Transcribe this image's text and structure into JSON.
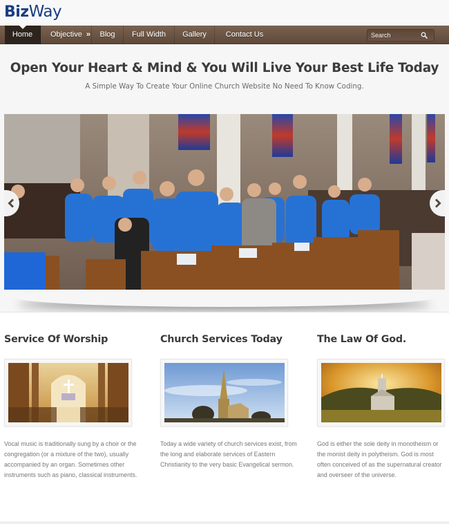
{
  "site": {
    "logo_bold": "Biz",
    "logo_light": "Way",
    "brand_color": "#1b3d82"
  },
  "nav": {
    "items": [
      {
        "label": "Home",
        "active": true
      },
      {
        "label": "Objective",
        "has_submenu": true,
        "submenu_indicator": "»"
      },
      {
        "label": "Blog"
      },
      {
        "label": "Full Width"
      },
      {
        "label": "Gallery"
      },
      {
        "label": "Contact Us"
      }
    ],
    "search": {
      "placeholder": "Search",
      "icon": "search-icon"
    },
    "bar_color": "#6b5444",
    "active_color": "#2e241e"
  },
  "hero": {
    "title": "Open Your Heart & Mind & You Will Live Your Best Life Today",
    "subtitle": "A Simple Way To Create Your Online Church Website No Need To Know Coding.",
    "slider": {
      "image_description": "Church congregation in blue t-shirts standing in pews",
      "prev_icon": "chevron-left-icon",
      "next_icon": "chevron-right-icon"
    }
  },
  "features": [
    {
      "title": "Service Of Worship",
      "image_description": "Church interior with cross and golden light",
      "text": "Vocal music is traditionally sung by a choir or the congregation (or a mixture of the two), usually accompanied by an organ. Sometimes other instruments such as piano, classical instruments."
    },
    {
      "title": "Church Services Today",
      "image_description": "Stone church with spire under blue sky",
      "text": "Today a wide variety of church services exist, from the long and elaborate services of Eastern Christianity to the very basic Evangelical sermon."
    },
    {
      "title": "The Law Of God.",
      "image_description": "Small chapel in a field at golden sunset",
      "text": "God is either the sole deity in monotheism or the monist deity in polytheism. God is most often conceived of as the supernatural creator and overseer of the universe."
    }
  ]
}
